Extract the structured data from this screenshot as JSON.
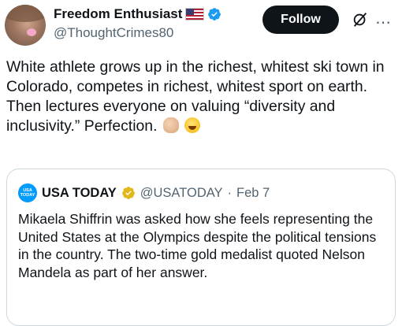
{
  "author": {
    "display_name": "Freedom Enthusiast",
    "handle": "@ThoughtCrimes80",
    "badges": [
      "us-flag-icon",
      "verified-icon"
    ]
  },
  "actions": {
    "follow_label": "Follow",
    "icons": [
      "grok-icon",
      "more-icon"
    ]
  },
  "tweet": {
    "text": "White athlete grows up in the richest, whitest ski town in Colorado, competes in richest, whitest sport on earth. Then lectures everyone on valuing “diversity and inclusivity.” Perfection.",
    "emojis": [
      "ok-hand-icon",
      "tears-of-joy-icon"
    ]
  },
  "quoted": {
    "logo_text": "USA TODAY",
    "display_name": "USA TODAY",
    "handle": "@USATODAY",
    "separator": "·",
    "date": "Feb 7",
    "text": "Mikaela Shiffrin was asked how she feels representing the United States at the Olympics despite the political tensions in the country.  The two-time gold medalist quoted Nelson Mandela as part of her answer."
  },
  "colors": {
    "verified_blue": "#1d9bf0",
    "verified_gold": "#e2b719",
    "follow_bg": "#0f1419",
    "secondary_text": "#536471",
    "border": "#cfd9de"
  }
}
